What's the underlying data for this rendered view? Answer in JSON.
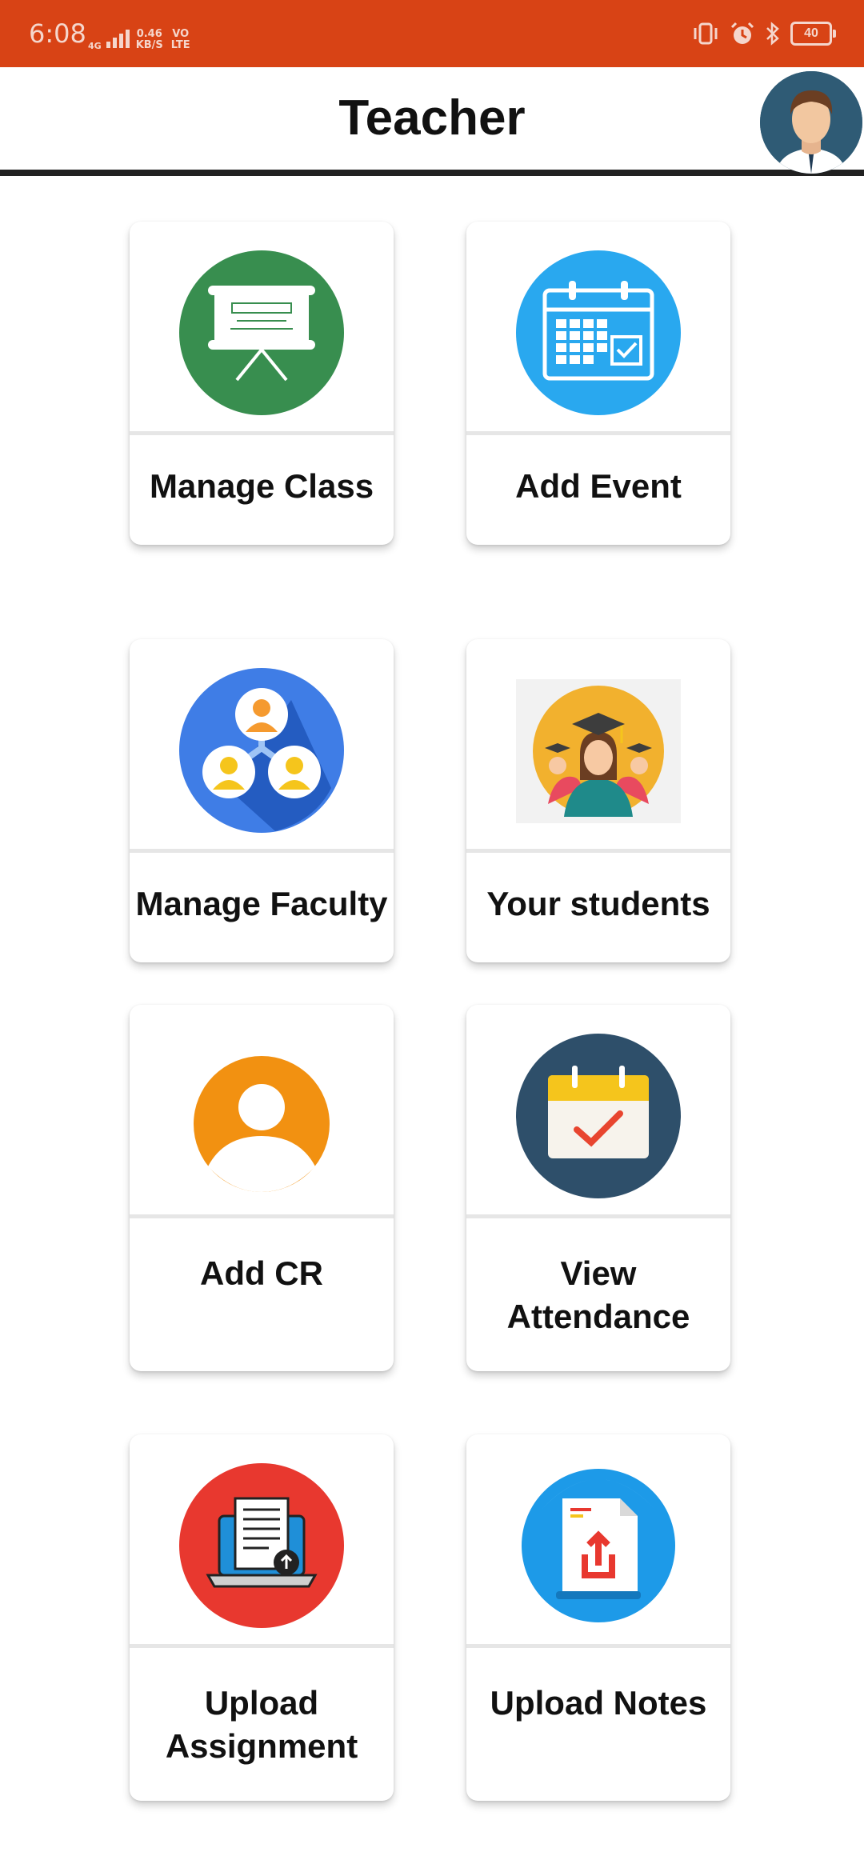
{
  "status_bar": {
    "time": "6:08",
    "network": "4G",
    "speed_value": "0.46",
    "speed_unit": "KB/S",
    "volte_top": "VO",
    "volte_bottom": "LTE",
    "battery": "40",
    "colors": {
      "background": "#d84315"
    }
  },
  "header": {
    "title": "Teacher",
    "avatar_icon": "profile-avatar-icon"
  },
  "menu": {
    "items": [
      {
        "label": "Manage Class",
        "icon": "presentation-board-icon",
        "color": "#388e4f"
      },
      {
        "label": "Add Event",
        "icon": "calendar-icon",
        "color": "#29a8ef"
      },
      {
        "label": "Manage Faculty",
        "icon": "faculty-group-icon",
        "color": "#3f7de6"
      },
      {
        "label": "Your students",
        "icon": "graduates-icon",
        "color": "#f2b12e"
      },
      {
        "label": "Add CR",
        "icon": "person-icon",
        "color": "#f29111"
      },
      {
        "label": "View Attendance",
        "label_line1": "View",
        "label_line2": "Attendance",
        "icon": "attendance-calendar-icon",
        "color": "#2e4f6a"
      },
      {
        "label": "Upload Assignment",
        "label_line1": "Upload",
        "label_line2": "Assignment",
        "icon": "upload-assignment-icon",
        "color": "#e8382f"
      },
      {
        "label": "Upload Notes",
        "icon": "upload-notes-icon",
        "color": "#1d9ae8"
      }
    ]
  }
}
